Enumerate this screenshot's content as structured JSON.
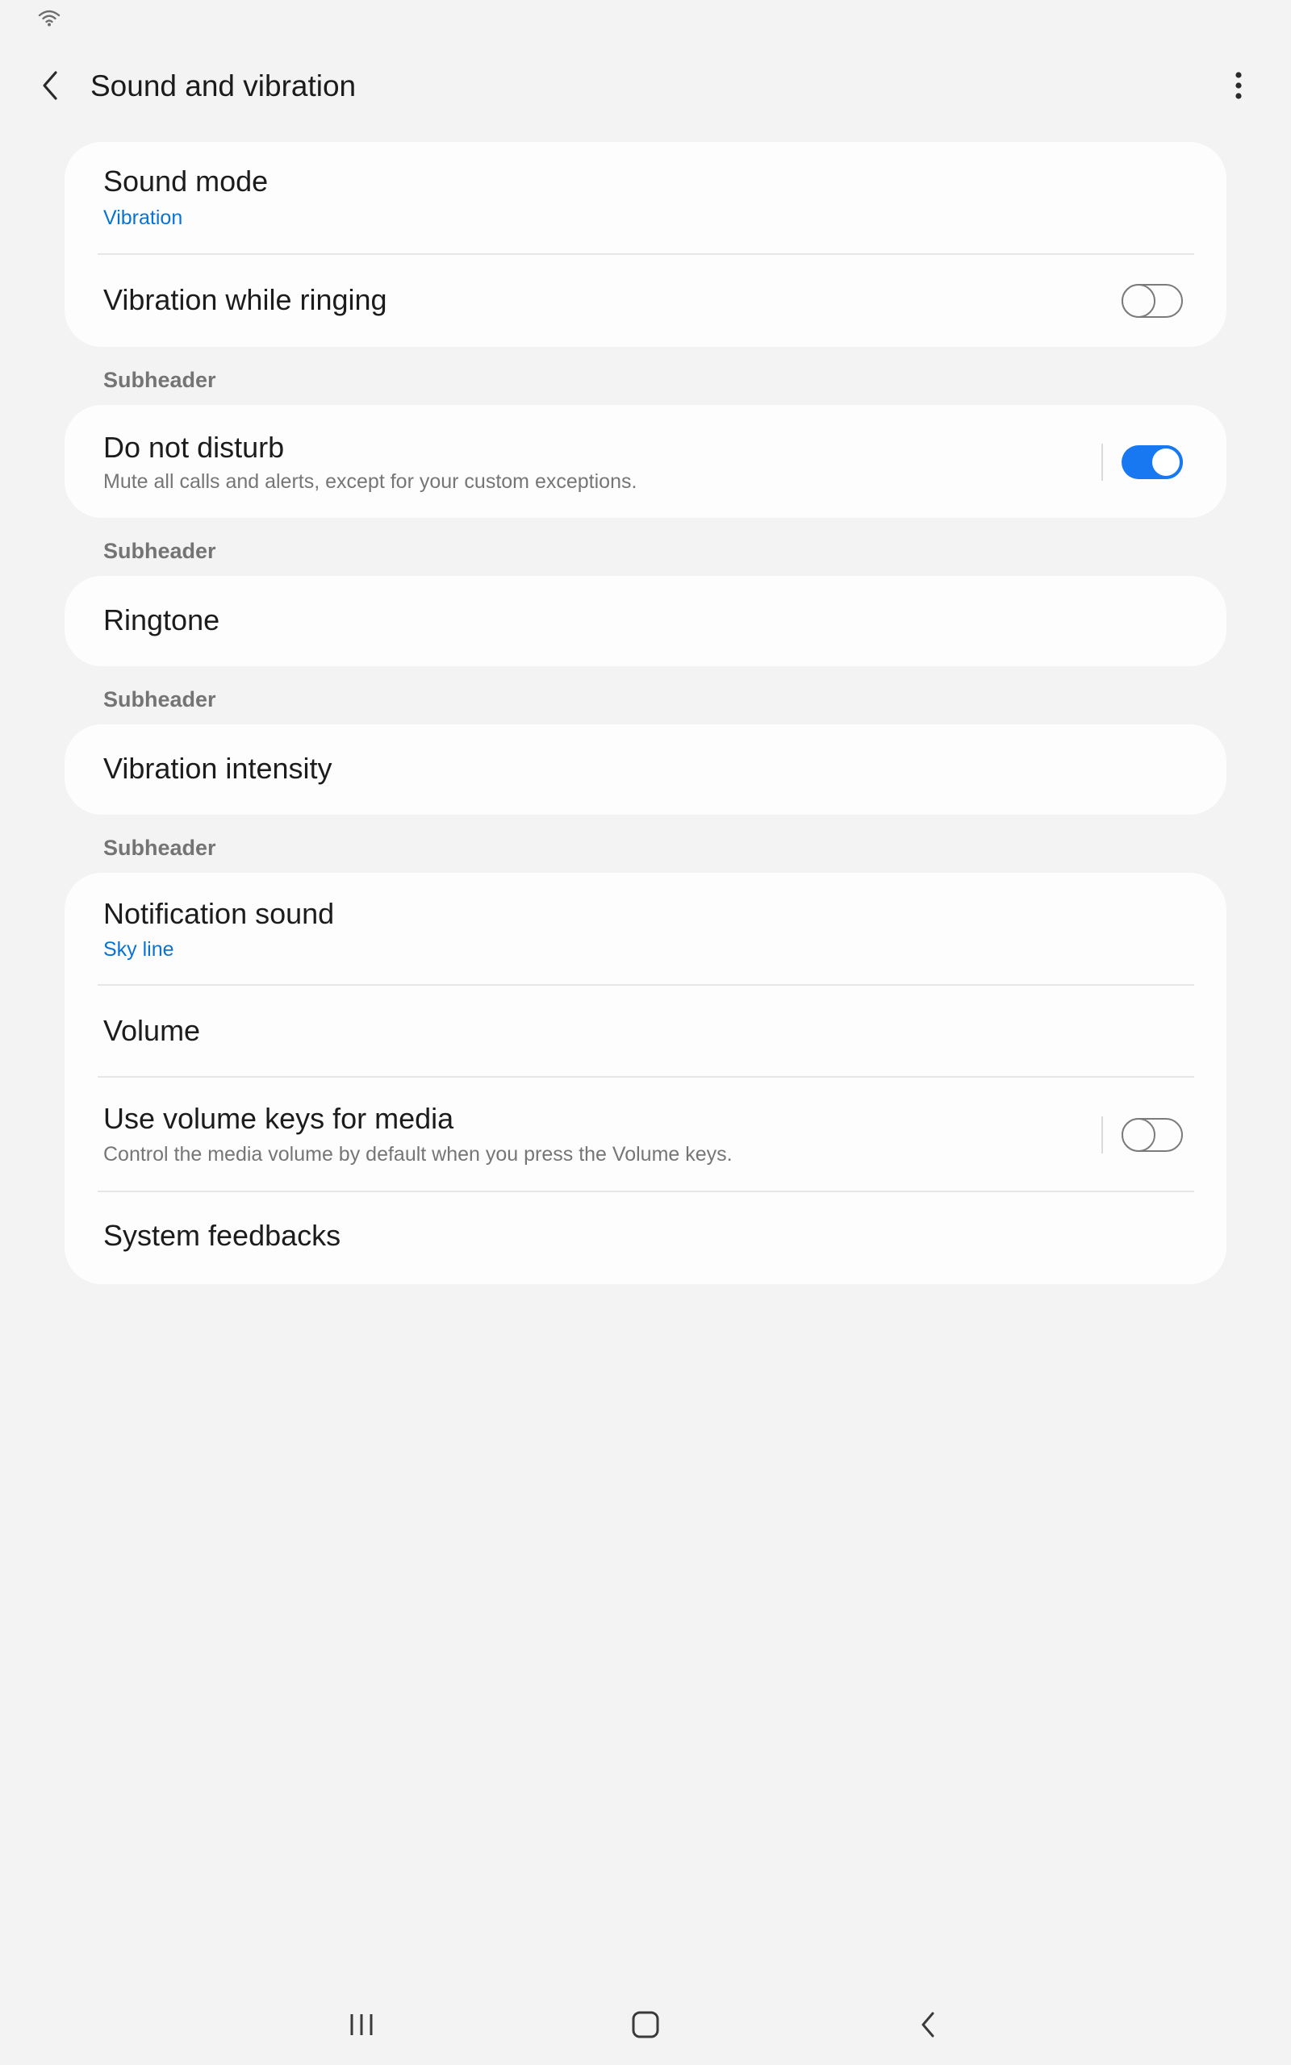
{
  "status_bar": {
    "wifi_icon": "wifi-icon"
  },
  "app_bar": {
    "title": "Sound and vibration",
    "back_icon": "chevron-left-icon",
    "more_icon": "more-vertical-icon"
  },
  "sections": {
    "card1": {
      "sound_mode": {
        "title": "Sound mode",
        "value": "Vibration"
      },
      "vibration_while_ringing": {
        "title": "Vibration while ringing",
        "enabled": false
      }
    },
    "subheader1": "Subheader",
    "card2": {
      "do_not_disturb": {
        "title": "Do not disturb",
        "summary": "Mute all calls and alerts, except for your custom exceptions.",
        "enabled": true
      }
    },
    "subheader2": "Subheader",
    "card3": {
      "ringtone": {
        "title": "Ringtone"
      }
    },
    "subheader3": "Subheader",
    "card4": {
      "vibration_intensity": {
        "title": "Vibration intensity"
      }
    },
    "subheader4": "Subheader",
    "card5": {
      "notification_sound": {
        "title": "Notification sound",
        "value": "Sky line"
      },
      "volume": {
        "title": "Volume"
      },
      "use_volume_keys": {
        "title": "Use volume keys for media",
        "summary": "Control the media volume by default when you press the Volume keys.",
        "enabled": false
      },
      "system_feedbacks": {
        "title": "System feedbacks"
      }
    }
  },
  "nav_bar": {
    "recents_icon": "recents-icon",
    "home_icon": "home-icon",
    "back_icon": "back-icon"
  },
  "colors": {
    "accent": "#1778f2",
    "link_blue": "#0a73d1",
    "background": "#f3f3f3",
    "card": "#fdfdfd",
    "subheader_gray": "#747474"
  }
}
